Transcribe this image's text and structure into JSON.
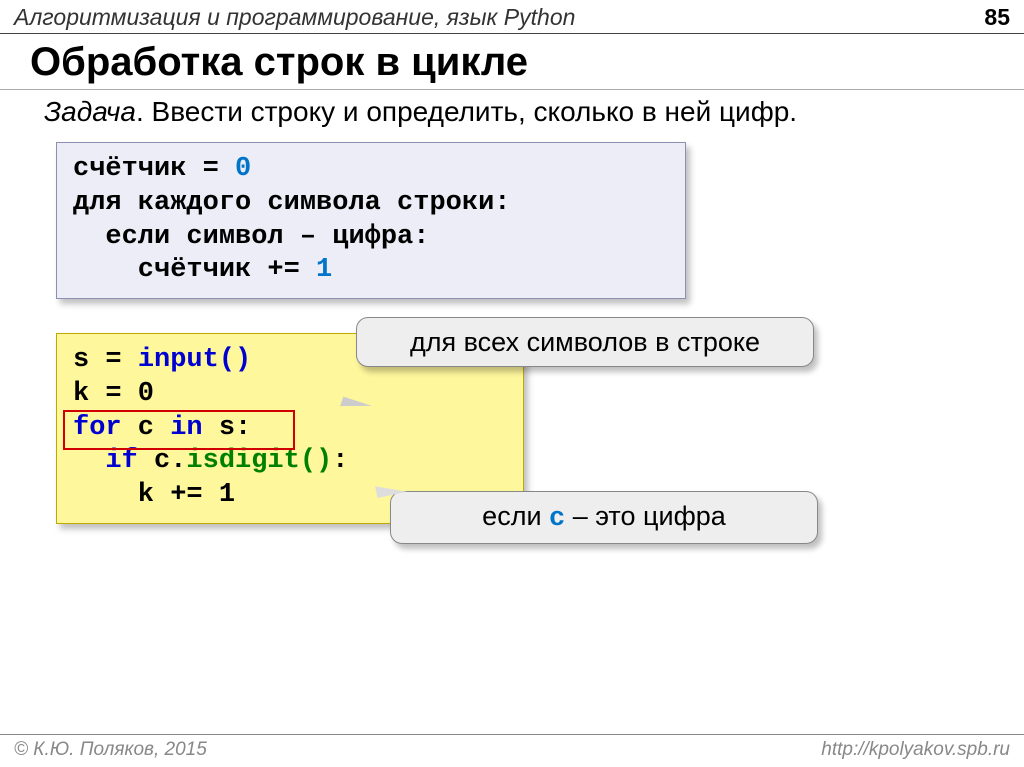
{
  "header": {
    "chapter": "Алгоритмизация и программирование, язык Python",
    "page": "85"
  },
  "title": "Обработка строк в цикле",
  "task": {
    "label": "Задача",
    "text": ". Ввести строку и определить, сколько в ней цифр."
  },
  "pseudo": {
    "l1a": "счётчик = ",
    "l1b": "0",
    "l2": "для каждого символа строки:",
    "l3": "  если символ – цифра:",
    "l4a": "    счётчик += ",
    "l4b": "1"
  },
  "code": {
    "l1a": "s = ",
    "l1b": "input()",
    "l2": "k = 0",
    "l3a": "for",
    "l3b": " c ",
    "l3c": "in",
    "l3d": " s:",
    "l4a": "  if",
    "l4b": " c.",
    "l4c": "isdigit()",
    "l4d": ":",
    "l5": "    k += 1"
  },
  "callouts": {
    "top": "для всех символов в строке",
    "bottom_pre": "если ",
    "bottom_code": "c",
    "bottom_post": " – это цифра"
  },
  "footer": {
    "copyright": "© К.Ю. Поляков, 2015",
    "url": "http://kpolyakov.spb.ru"
  }
}
